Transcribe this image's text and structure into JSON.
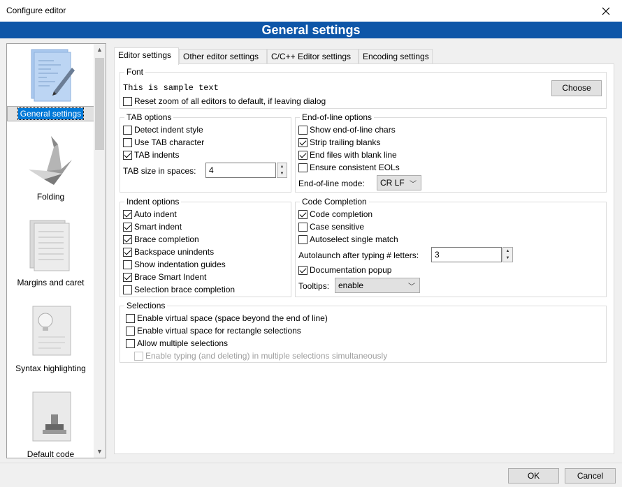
{
  "window": {
    "title": "Configure editor"
  },
  "header": {
    "title": "General settings"
  },
  "sidebar": {
    "items": [
      {
        "label": "General settings",
        "icon": "notepad-pen-icon",
        "selected": true
      },
      {
        "label": "Folding",
        "icon": "origami-bird-icon"
      },
      {
        "label": "Margins and caret",
        "icon": "pages-icon"
      },
      {
        "label": "Syntax highlighting",
        "icon": "lightbulb-page-icon"
      },
      {
        "label": "Default code",
        "icon": "stamp-page-icon"
      }
    ]
  },
  "tabs": [
    {
      "label": "Editor settings",
      "active": true
    },
    {
      "label": "Other editor settings"
    },
    {
      "label": "C/C++ Editor settings"
    },
    {
      "label": "Encoding settings"
    }
  ],
  "font": {
    "title": "Font",
    "sample": "This is sample text",
    "reset_zoom": {
      "label": "Reset zoom of all editors to default, if leaving dialog",
      "checked": false
    },
    "choose_label": "Choose"
  },
  "tab_options": {
    "title": "TAB options",
    "items": [
      {
        "label": "Detect indent style",
        "checked": false
      },
      {
        "label": "Use TAB character",
        "checked": false
      },
      {
        "label": "TAB indents",
        "checked": true
      }
    ],
    "size_label": "TAB size in spaces:",
    "size_value": "4"
  },
  "eol_options": {
    "title": "End-of-line options",
    "items": [
      {
        "label": "Show end-of-line chars",
        "checked": false
      },
      {
        "label": "Strip trailing blanks",
        "checked": true
      },
      {
        "label": "End files with blank line",
        "checked": true
      },
      {
        "label": "Ensure consistent EOLs",
        "checked": false
      }
    ],
    "mode_label": "End-of-line mode:",
    "mode_value": "CR LF"
  },
  "indent_options": {
    "title": "Indent options",
    "items": [
      {
        "label": "Auto indent",
        "checked": true
      },
      {
        "label": "Smart indent",
        "checked": true
      },
      {
        "label": "Brace completion",
        "checked": true
      },
      {
        "label": "Backspace unindents",
        "checked": true
      },
      {
        "label": "Show indentation guides",
        "checked": false
      },
      {
        "label": "Brace Smart Indent",
        "checked": true
      },
      {
        "label": "Selection brace completion",
        "checked": false
      }
    ]
  },
  "code_completion": {
    "title": "Code Completion",
    "items": [
      {
        "label": "Code completion",
        "checked": true
      },
      {
        "label": "Case sensitive",
        "checked": false
      },
      {
        "label": "Autoselect single match",
        "checked": false
      }
    ],
    "autolaunch_label": "Autolaunch after typing # letters:",
    "autolaunch_value": "3",
    "doc_popup": {
      "label": "Documentation popup",
      "checked": true
    },
    "tooltips_label": "Tooltips:",
    "tooltips_value": "enable"
  },
  "selections": {
    "title": "Selections",
    "items": [
      {
        "label": "Enable virtual space (space beyond the end of line)",
        "checked": false
      },
      {
        "label": "Enable virtual space for rectangle selections",
        "checked": false
      },
      {
        "label": "Allow multiple selections",
        "checked": false
      },
      {
        "label": "Enable typing (and deleting) in multiple selections simultaneously",
        "checked": false,
        "disabled": true
      }
    ]
  },
  "footer": {
    "ok_label": "OK",
    "cancel_label": "Cancel"
  },
  "colors": {
    "header_band": "#0e56a8",
    "selection": "#0078d7"
  }
}
